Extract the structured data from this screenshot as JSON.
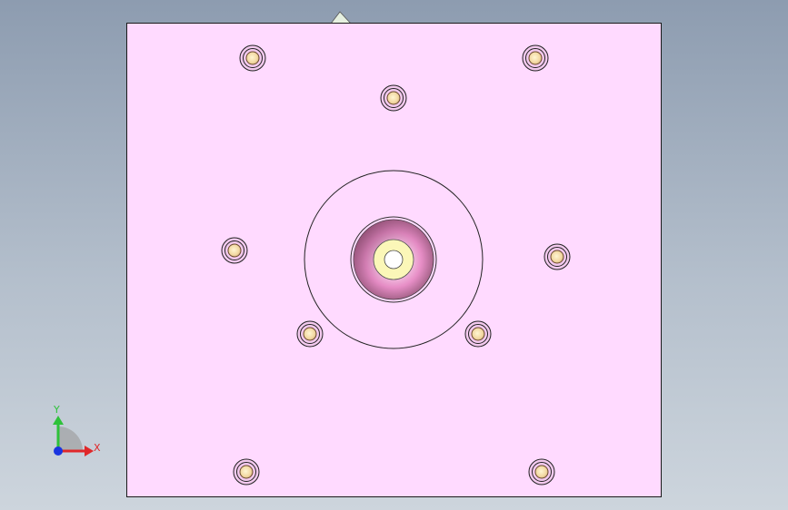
{
  "viewport": {
    "background_top": "#8d9cb0",
    "background_bottom": "#cdd5dd"
  },
  "part": {
    "face_color": "#ffdaff",
    "edge_color": "#1a1a1a",
    "top_nub_color": "#e6f0e0"
  },
  "holes": {
    "count": 10,
    "inner_fill": "#f7e7b0",
    "ring_fill": "#f3c9ee"
  },
  "center_feature": {
    "cone_dark": "#8a4a6e",
    "cone_light": "#f3a8d6",
    "washer_fill": "#fbf7b8",
    "bore_fill": "#ffffff"
  },
  "triad": {
    "x_label": "X",
    "y_label": "Y",
    "x_color": "#e0282a",
    "y_color": "#2ec23a",
    "z_color": "#1a35e0"
  }
}
